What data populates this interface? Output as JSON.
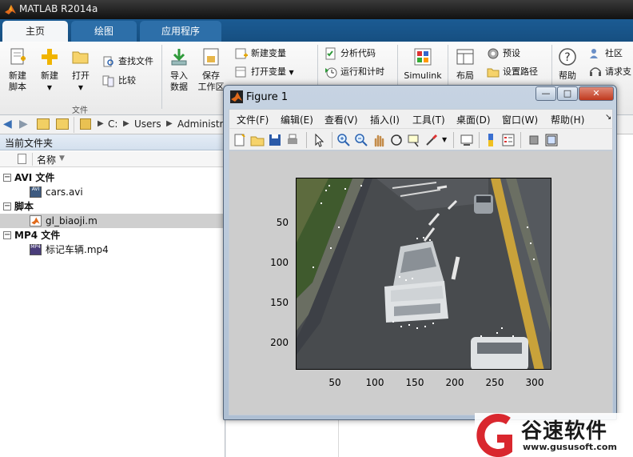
{
  "app": {
    "title": "MATLAB R2014a"
  },
  "tabs": [
    {
      "label": "主页",
      "active": true
    },
    {
      "label": "绘图",
      "active": false
    },
    {
      "label": "应用程序",
      "active": false
    }
  ],
  "ribbon": {
    "new_script": "新建\n脚本",
    "new": "新建",
    "open": "打开",
    "find_files": "查找文件",
    "compare": "比较",
    "file_group": "文件",
    "import_data": "导入\n数据",
    "save_workspace": "保存\n工作区",
    "new_variable": "新建变量",
    "open_variable": "打开变量",
    "analyze_code": "分析代码",
    "run_and_time": "运行和计时",
    "simulink": "Simulink",
    "layout": "布局",
    "preferences": "预设",
    "set_path": "设置路径",
    "help": "帮助",
    "community": "社区",
    "request_support": "请求支"
  },
  "address": {
    "segments": [
      "C:",
      "Users",
      "Administr"
    ]
  },
  "left_pane": {
    "title": "当前文件夹",
    "column_name": "名称",
    "groups": [
      {
        "label": "AVI 文件",
        "files": [
          {
            "name": "cars.avi",
            "selected": false
          }
        ]
      },
      {
        "label": "脚本",
        "files": [
          {
            "name": "gl_biaoji.m",
            "selected": true
          }
        ]
      },
      {
        "label": "MP4 文件",
        "files": [
          {
            "name": "标记车辆.mp4",
            "selected": false
          }
        ]
      }
    ]
  },
  "figure": {
    "title": "Figure 1",
    "menu": [
      "文件(F)",
      "编辑(E)",
      "查看(V)",
      "插入(I)",
      "工具(T)",
      "桌面(D)",
      "窗口(W)",
      "帮助(H)"
    ],
    "window_buttons": {
      "minimize": "—",
      "maximize": "□",
      "close": "✕"
    },
    "axes": {
      "y_ticks": [
        "50",
        "100",
        "150",
        "200"
      ],
      "x_ticks": [
        "50",
        "100",
        "150",
        "200",
        "250",
        "300"
      ]
    }
  },
  "watermark": {
    "brand": "谷速软件",
    "url": "www.gususoft.com"
  }
}
